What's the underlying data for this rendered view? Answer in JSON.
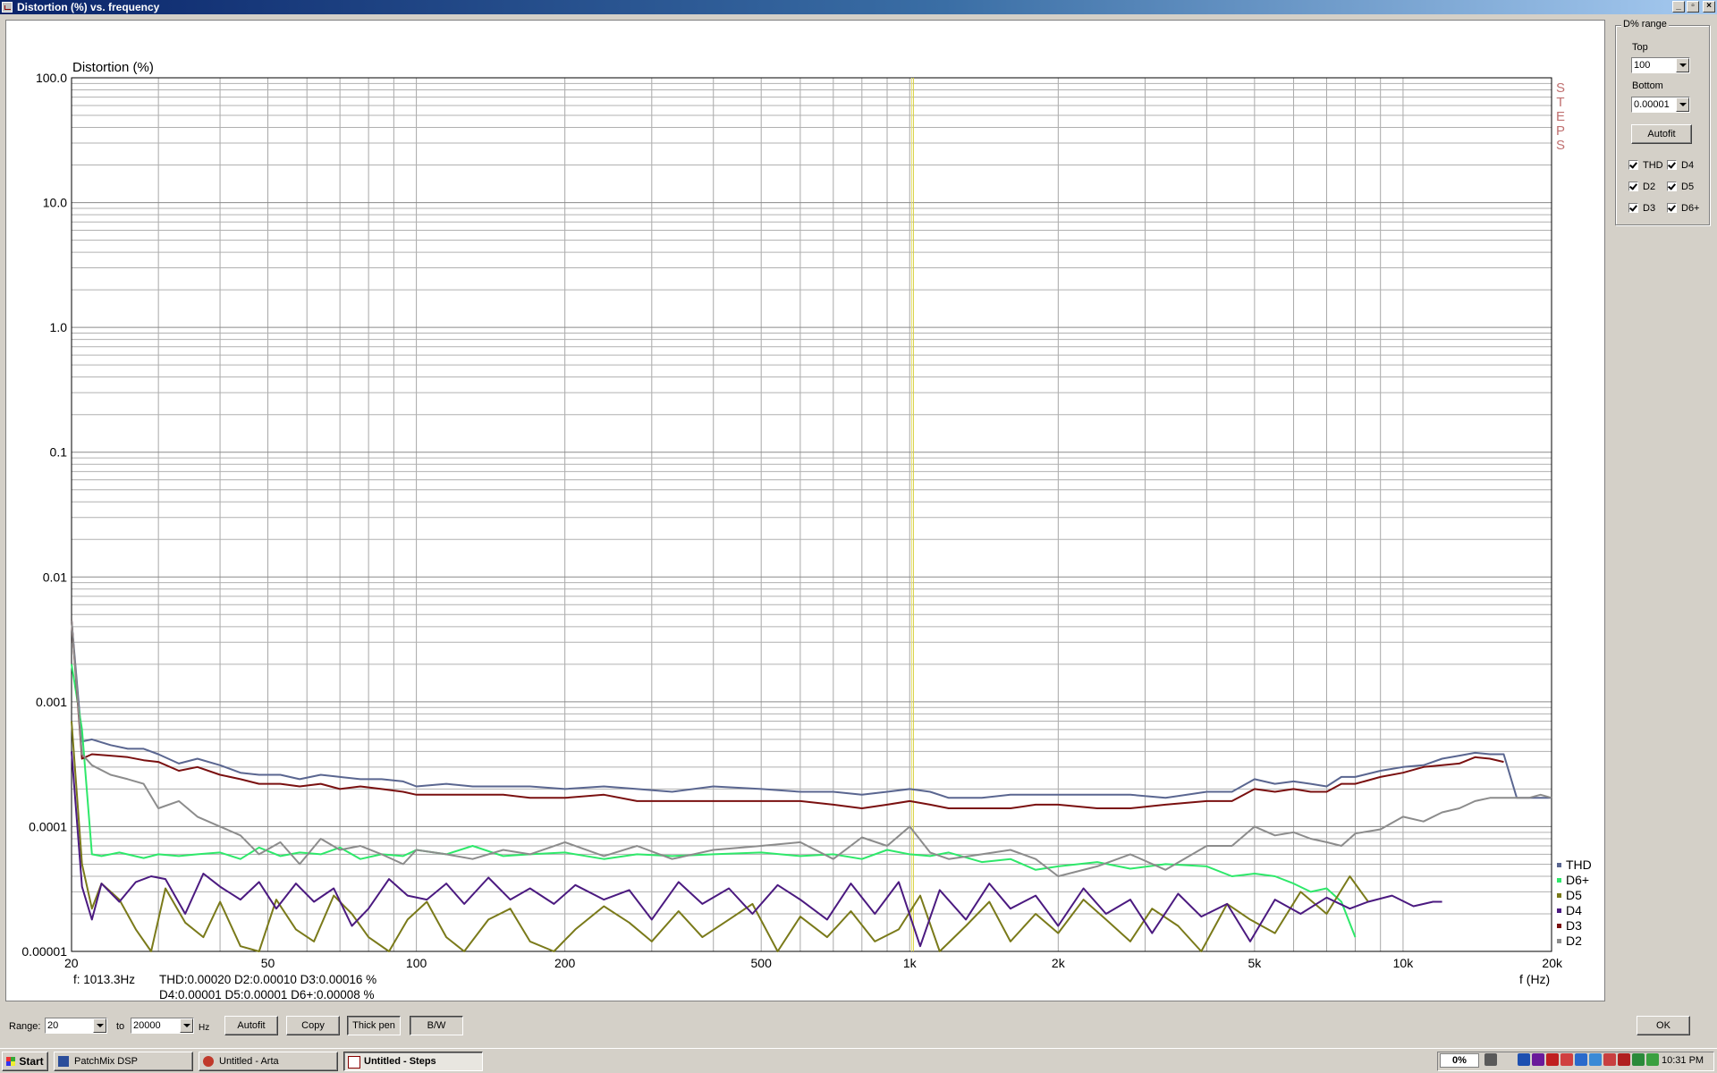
{
  "window": {
    "title": "Distortion (%) vs. frequency"
  },
  "chart_data": {
    "type": "line",
    "title": "",
    "ylabel": "Distortion (%)",
    "xlabel": "f (Hz)",
    "xscale": "log",
    "yscale": "log",
    "xlim": [
      20,
      20000
    ],
    "ylim": [
      1e-05,
      100
    ],
    "x_tick_labels": [
      {
        "value": 20,
        "label": "20"
      },
      {
        "value": 50,
        "label": "50"
      },
      {
        "value": 100,
        "label": "100"
      },
      {
        "value": 200,
        "label": "200"
      },
      {
        "value": 500,
        "label": "500"
      },
      {
        "value": 1000,
        "label": "1k"
      },
      {
        "value": 2000,
        "label": "2k"
      },
      {
        "value": 5000,
        "label": "5k"
      },
      {
        "value": 10000,
        "label": "10k"
      },
      {
        "value": 20000,
        "label": "20k"
      }
    ],
    "y_tick_labels": [
      {
        "value": 100,
        "label": "100.0"
      },
      {
        "value": 10,
        "label": "10.0"
      },
      {
        "value": 1,
        "label": "1.0"
      },
      {
        "value": 0.1,
        "label": "0.1"
      },
      {
        "value": 0.01,
        "label": "0.01"
      },
      {
        "value": 0.001,
        "label": "0.001"
      },
      {
        "value": 0.0001,
        "label": "0.0001"
      },
      {
        "value": 1e-05,
        "label": "0.00001"
      }
    ],
    "grid": true,
    "cursor_frequency": 1013.3,
    "side_text": "STEPS",
    "legend_position": "bottom-right",
    "series": [
      {
        "name": "THD",
        "color": "#5a6690",
        "x": [
          20,
          21,
          22,
          24,
          26,
          28,
          30,
          33,
          36,
          40,
          44,
          48,
          53,
          58,
          64,
          70,
          77,
          85,
          94,
          100,
          115,
          130,
          150,
          170,
          200,
          240,
          280,
          330,
          400,
          500,
          600,
          700,
          800,
          900,
          1000,
          1100,
          1200,
          1400,
          1600,
          1800,
          2000,
          2400,
          2800,
          3300,
          4000,
          4500,
          5000,
          5500,
          6000,
          6500,
          7000,
          7500,
          8000,
          9000,
          10000,
          11000,
          12000,
          13000,
          14000,
          15000,
          16000,
          17000,
          18000,
          19000,
          20000
        ],
        "y": [
          0.0045,
          0.00048,
          0.0005,
          0.00045,
          0.00042,
          0.00042,
          0.00038,
          0.00032,
          0.00035,
          0.00031,
          0.00027,
          0.00026,
          0.00026,
          0.00024,
          0.00026,
          0.00025,
          0.00024,
          0.00024,
          0.00023,
          0.00021,
          0.00022,
          0.00021,
          0.00021,
          0.00021,
          0.0002,
          0.00021,
          0.0002,
          0.00019,
          0.00021,
          0.0002,
          0.00019,
          0.00019,
          0.00018,
          0.00019,
          0.0002,
          0.00019,
          0.00017,
          0.00017,
          0.00018,
          0.00018,
          0.00018,
          0.00018,
          0.00018,
          0.00017,
          0.00019,
          0.00019,
          0.00024,
          0.00022,
          0.00023,
          0.00022,
          0.00021,
          0.00025,
          0.00025,
          0.00028,
          0.0003,
          0.00031,
          0.00035,
          0.00037,
          0.00039,
          0.00038,
          0.00038,
          0.00017,
          0.00017,
          0.00017,
          0.00017
        ]
      },
      {
        "name": "D6+",
        "color": "#2ee86a",
        "x": [
          20,
          21,
          22,
          23,
          25,
          28,
          30,
          33,
          36,
          40,
          44,
          48,
          53,
          58,
          64,
          70,
          77,
          85,
          94,
          100,
          115,
          130,
          150,
          170,
          200,
          240,
          280,
          330,
          400,
          500,
          600,
          700,
          800,
          900,
          1000,
          1100,
          1200,
          1400,
          1600,
          1800,
          2000,
          2400,
          2800,
          3300,
          4000,
          4500,
          5000,
          5500,
          6000,
          6500,
          7000,
          7500,
          8000
        ],
        "y": [
          0.002,
          0.0006,
          6e-05,
          5.8e-05,
          6.2e-05,
          5.6e-05,
          6e-05,
          5.8e-05,
          6e-05,
          6.2e-05,
          5.5e-05,
          6.8e-05,
          5.8e-05,
          6.2e-05,
          6e-05,
          6.8e-05,
          5.5e-05,
          6e-05,
          5.8e-05,
          6.5e-05,
          6e-05,
          7e-05,
          5.8e-05,
          6e-05,
          6.2e-05,
          5.5e-05,
          6e-05,
          5.8e-05,
          6e-05,
          6.2e-05,
          5.8e-05,
          6e-05,
          5.5e-05,
          6.5e-05,
          6e-05,
          5.8e-05,
          6.2e-05,
          5.2e-05,
          5.5e-05,
          4.5e-05,
          4.8e-05,
          5.2e-05,
          4.6e-05,
          5e-05,
          4.8e-05,
          4e-05,
          4.2e-05,
          4e-05,
          3.5e-05,
          3e-05,
          3.2e-05,
          2.5e-05,
          1.3e-05
        ]
      },
      {
        "name": "D5",
        "color": "#7a7a1a",
        "x": [
          20,
          21,
          22,
          23,
          25,
          27,
          29,
          31,
          34,
          37,
          40,
          44,
          48,
          52,
          57,
          62,
          68,
          74,
          80,
          88,
          96,
          105,
          115,
          125,
          140,
          155,
          170,
          190,
          210,
          240,
          270,
          300,
          340,
          380,
          430,
          480,
          540,
          600,
          680,
          760,
          850,
          950,
          1050,
          1150,
          1300,
          1450,
          1600,
          1800,
          2000,
          2250,
          2500,
          2800,
          3100,
          3500,
          3900,
          4400,
          4900,
          5500,
          6200,
          7000,
          7800,
          8500
        ],
        "y": [
          0.0007,
          5e-05,
          2.2e-05,
          3.5e-05,
          2.6e-05,
          1.5e-05,
          1e-05,
          3.2e-05,
          1.7e-05,
          1.3e-05,
          2.5e-05,
          1.1e-05,
          1e-05,
          2.6e-05,
          1.5e-05,
          1.2e-05,
          2.8e-05,
          2e-05,
          1.3e-05,
          1e-05,
          1.8e-05,
          2.5e-05,
          1.3e-05,
          1e-05,
          1.8e-05,
          2.2e-05,
          1.2e-05,
          1e-05,
          1.5e-05,
          2.3e-05,
          1.7e-05,
          1.2e-05,
          2.1e-05,
          1.3e-05,
          1.8e-05,
          2.4e-05,
          1e-05,
          1.9e-05,
          1.3e-05,
          2.1e-05,
          1.2e-05,
          1.5e-05,
          2.8e-05,
          1e-05,
          1.6e-05,
          2.5e-05,
          1.2e-05,
          2e-05,
          1.4e-05,
          2.6e-05,
          1.8e-05,
          1.2e-05,
          2.2e-05,
          1.6e-05,
          1e-05,
          2.4e-05,
          1.8e-05,
          1.4e-05,
          3e-05,
          2e-05,
          4e-05,
          2.5e-05
        ]
      },
      {
        "name": "D4",
        "color": "#4b1a80",
        "x": [
          20,
          21,
          22,
          23,
          25,
          27,
          29,
          31,
          34,
          37,
          40,
          44,
          48,
          52,
          57,
          62,
          68,
          74,
          80,
          88,
          96,
          105,
          115,
          125,
          140,
          155,
          170,
          190,
          210,
          240,
          270,
          300,
          340,
          380,
          430,
          480,
          540,
          600,
          680,
          760,
          850,
          950,
          1050,
          1150,
          1300,
          1450,
          1600,
          1800,
          2000,
          2250,
          2500,
          2800,
          3100,
          3500,
          3900,
          4400,
          4900,
          5500,
          6200,
          7000,
          7800,
          8500,
          9500,
          10500,
          11500,
          12000
        ],
        "y": [
          0.0004,
          3.3e-05,
          1.8e-05,
          3.5e-05,
          2.5e-05,
          3.6e-05,
          4e-05,
          3.8e-05,
          2e-05,
          4.2e-05,
          3.3e-05,
          2.6e-05,
          3.6e-05,
          2.2e-05,
          3.5e-05,
          2.5e-05,
          3.2e-05,
          1.6e-05,
          2.2e-05,
          3.8e-05,
          2.8e-05,
          2.6e-05,
          3.5e-05,
          2.4e-05,
          3.9e-05,
          2.6e-05,
          3.2e-05,
          2.4e-05,
          3.4e-05,
          2.6e-05,
          3.1e-05,
          1.8e-05,
          3.6e-05,
          2.4e-05,
          3.2e-05,
          2e-05,
          3.4e-05,
          2.6e-05,
          1.8e-05,
          3.5e-05,
          2e-05,
          3.6e-05,
          1.1e-05,
          3.1e-05,
          1.8e-05,
          3.5e-05,
          2.2e-05,
          2.8e-05,
          1.6e-05,
          3.2e-05,
          2e-05,
          2.6e-05,
          1.4e-05,
          2.9e-05,
          1.9e-05,
          2.4e-05,
          1.2e-05,
          2.6e-05,
          2e-05,
          2.7e-05,
          2.2e-05,
          2.5e-05,
          2.8e-05,
          2.3e-05,
          2.5e-05,
          2.5e-05
        ]
      },
      {
        "name": "D3",
        "color": "#7a1010",
        "x": [
          20,
          21,
          22,
          24,
          26,
          28,
          30,
          33,
          36,
          40,
          44,
          48,
          53,
          58,
          64,
          70,
          77,
          85,
          94,
          100,
          115,
          130,
          150,
          170,
          200,
          240,
          280,
          330,
          400,
          500,
          600,
          700,
          800,
          900,
          1000,
          1100,
          1200,
          1400,
          1600,
          1800,
          2000,
          2400,
          2800,
          3300,
          4000,
          4500,
          5000,
          5500,
          6000,
          6500,
          7000,
          7500,
          8000,
          9000,
          10000,
          11000,
          12000,
          13000,
          14000,
          15000,
          16000
        ],
        "y": [
          0.0045,
          0.00035,
          0.00038,
          0.00037,
          0.00036,
          0.00034,
          0.00033,
          0.00028,
          0.0003,
          0.00026,
          0.00024,
          0.00022,
          0.00022,
          0.00021,
          0.00022,
          0.0002,
          0.00021,
          0.0002,
          0.00019,
          0.00018,
          0.00018,
          0.00018,
          0.00018,
          0.00017,
          0.00017,
          0.00018,
          0.00016,
          0.00016,
          0.00016,
          0.00016,
          0.00016,
          0.00015,
          0.00014,
          0.00015,
          0.00016,
          0.00015,
          0.00014,
          0.00014,
          0.00014,
          0.00015,
          0.00015,
          0.00014,
          0.00014,
          0.00015,
          0.00016,
          0.00016,
          0.0002,
          0.00019,
          0.0002,
          0.00019,
          0.00019,
          0.00022,
          0.00022,
          0.00025,
          0.00027,
          0.0003,
          0.00031,
          0.00032,
          0.00036,
          0.00035,
          0.00033
        ]
      },
      {
        "name": "D2",
        "color": "#8c8c8c",
        "x": [
          20,
          21,
          22,
          24,
          26,
          28,
          30,
          33,
          36,
          40,
          44,
          48,
          53,
          58,
          64,
          70,
          77,
          85,
          94,
          100,
          115,
          130,
          150,
          170,
          200,
          240,
          280,
          330,
          400,
          500,
          600,
          700,
          800,
          900,
          1000,
          1100,
          1200,
          1400,
          1600,
          1800,
          2000,
          2400,
          2800,
          3300,
          4000,
          4500,
          5000,
          5500,
          6000,
          6500,
          7000,
          7500,
          8000,
          9000,
          10000,
          11000,
          12000,
          13000,
          14000,
          15000,
          16000,
          17000,
          18000,
          19000,
          20000
        ],
        "y": [
          0.0045,
          0.00038,
          0.00031,
          0.00026,
          0.00024,
          0.00022,
          0.00014,
          0.00016,
          0.00012,
          0.0001,
          8.5e-05,
          6e-05,
          7.5e-05,
          5e-05,
          8e-05,
          6.5e-05,
          7e-05,
          6e-05,
          5e-05,
          6.5e-05,
          6e-05,
          5.5e-05,
          6.5e-05,
          6e-05,
          7.5e-05,
          5.8e-05,
          7e-05,
          5.5e-05,
          6.5e-05,
          7e-05,
          7.5e-05,
          5.5e-05,
          8.2e-05,
          7e-05,
          0.0001,
          6.2e-05,
          5.5e-05,
          6e-05,
          6.5e-05,
          5.5e-05,
          4e-05,
          4.8e-05,
          6e-05,
          4.5e-05,
          7e-05,
          7e-05,
          0.0001,
          8.5e-05,
          9e-05,
          8e-05,
          7.5e-05,
          7e-05,
          8.8e-05,
          9.5e-05,
          0.00012,
          0.00011,
          0.00013,
          0.00014,
          0.00016,
          0.00017,
          0.00017,
          0.00017,
          0.00017,
          0.00018,
          0.00017
        ]
      }
    ]
  },
  "readout": {
    "freq": "f: 1013.3Hz",
    "line1": "THD:0.00020  D2:0.00010  D3:0.00016 %",
    "line2": "D4:0.00001  D5:0.00001  D6+:0.00008 %"
  },
  "right_panel": {
    "group_label": "D% range",
    "top_label": "Top",
    "top_value": "100",
    "bottom_label": "Bottom",
    "bottom_value": "0.00001",
    "autofit": "Autofit",
    "checks": [
      {
        "label": "THD",
        "checked": true
      },
      {
        "label": "D4",
        "checked": true
      },
      {
        "label": "D2",
        "checked": true
      },
      {
        "label": "D5",
        "checked": true
      },
      {
        "label": "D3",
        "checked": true
      },
      {
        "label": "D6+",
        "checked": true
      }
    ]
  },
  "bottom_bar": {
    "range_label": "Range:",
    "range_from": "20",
    "to_label": "to",
    "range_to": "20000",
    "hz_label": "Hz",
    "autofit": "Autofit",
    "copy": "Copy",
    "thick_pen": "Thick pen",
    "bw": "B/W",
    "ok": "OK"
  },
  "taskbar": {
    "start": "Start",
    "tasks": [
      "PatchMix DSP",
      "Untitled - Arta",
      "Untitled - Steps"
    ],
    "active_task": "Untitled - Steps",
    "cpu": "0%",
    "clock": "10:31 PM"
  }
}
